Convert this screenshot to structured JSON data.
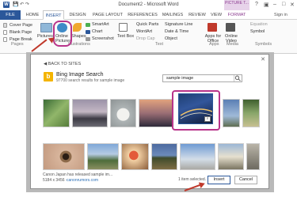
{
  "window": {
    "title": "Document2 - Microsoft Word",
    "picture_tools": "PICTURE T...",
    "sign_in": "Sign in"
  },
  "tabs": [
    "FILE",
    "HOME",
    "INSERT",
    "DESIGN",
    "PAGE LAYOUT",
    "REFERENCES",
    "MAILINGS",
    "REVIEW",
    "VIEW",
    "FORMAT"
  ],
  "ribbon": {
    "pages": {
      "cover_page": "Cover Page",
      "blank_page": "Blank Page",
      "page_break": "Page Break",
      "label": "Pages"
    },
    "illustrations": {
      "pictures": "Pictures",
      "online_pictures": "Online Pictures",
      "shapes": "Shapes",
      "smartart": "SmartArt",
      "chart": "Chart",
      "screenshot": "Screenshot",
      "label": "Illustrations"
    },
    "text": {
      "text_box": "Text Box",
      "quick_parts": "Quick Parts",
      "wordart": "WordArt",
      "drop_cap": "Drop Cap",
      "signature_line": "Signature Line",
      "date_time": "Date & Time",
      "object": "Object",
      "label": "Text"
    },
    "apps": {
      "apps_for_office": "Apps for Office",
      "label": "Apps"
    },
    "media": {
      "online_video": "Online Video",
      "label": "Media"
    },
    "symbols": {
      "equation": "Equation",
      "symbol": "Symbol",
      "label": "Symbols"
    }
  },
  "dialog": {
    "back": "BACK TO SITES",
    "source_title": "Bing Image Search",
    "result_count": "97700 search results for sample image",
    "search_value": "sample image",
    "caption_text": "Canon Japan has released    sample    im...",
    "caption_dims": "5184 x 3456 ·",
    "caption_link": "canonrumors.com",
    "status": "1 item selected.",
    "insert": "Insert",
    "cancel": "Cancel"
  },
  "colors": {
    "accent": "#2b579a",
    "selection": "#b8348a",
    "annotation": "#c0392b"
  },
  "icons": [
    "close-icon",
    "search-icon",
    "zoom-icon",
    "back-arrow-icon"
  ]
}
